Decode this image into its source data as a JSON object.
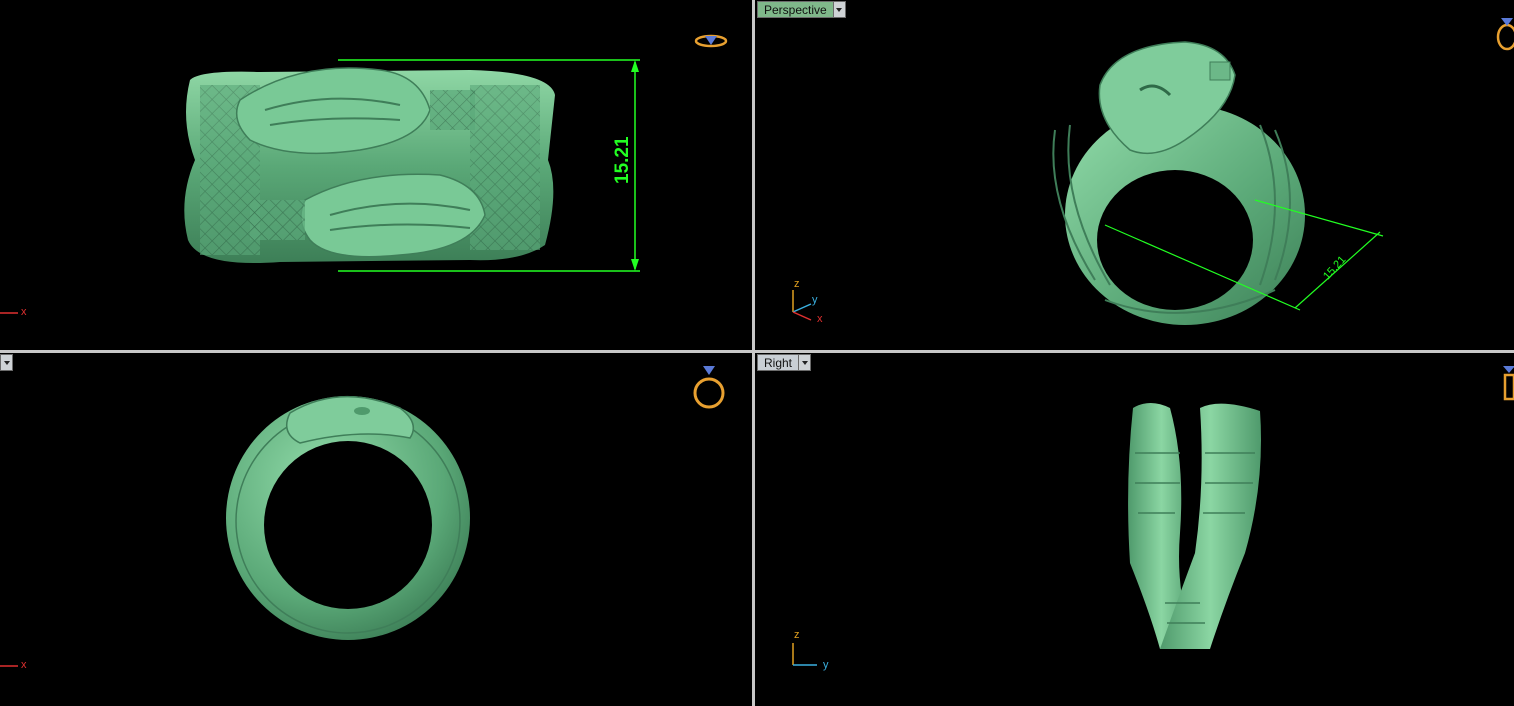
{
  "colors": {
    "model_green": "#6ec08a",
    "dimension_green": "#22ff22",
    "background": "#000000",
    "axis_x": "#e03030",
    "axis_y": "#3ab0e0",
    "axis_z": "#e0a020",
    "gem_icon": "#e8a030"
  },
  "viewports": {
    "top": {
      "dimension": "15.21",
      "axis_x": "x"
    },
    "perspective": {
      "label": "Perspective",
      "dimension": "15.21",
      "axis_z": "z",
      "axis_y": "y",
      "axis_x": "x"
    },
    "front": {
      "axis_x": "x"
    },
    "right": {
      "label": "Right",
      "axis_z": "z",
      "axis_y": "y"
    }
  },
  "icons": {
    "view_cube": "ring-gem-icon",
    "dropdown": "chevron-down-icon"
  }
}
